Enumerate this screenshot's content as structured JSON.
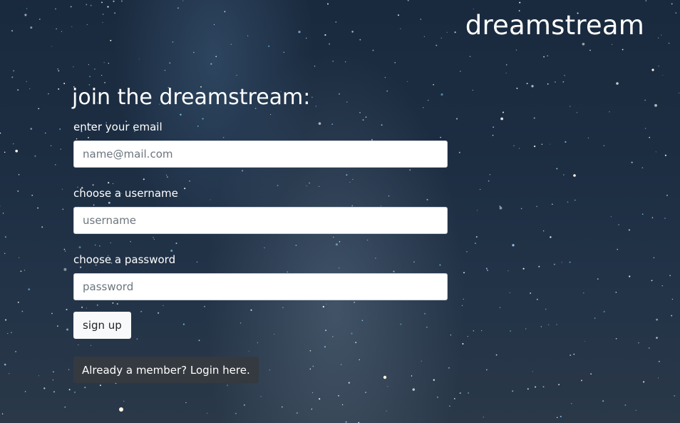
{
  "header": {
    "brand": "dreamstream"
  },
  "form": {
    "title": "join the dreamstream:",
    "fields": [
      {
        "label": "enter your email",
        "placeholder": "name@mail.com",
        "value": ""
      },
      {
        "label": "choose a username",
        "placeholder": "username",
        "value": ""
      },
      {
        "label": "choose a password",
        "placeholder": "password",
        "value": ""
      }
    ],
    "submit_label": "sign up",
    "login_link_label": "Already a member? Login here."
  },
  "colors": {
    "background_sky": "#1c2d42",
    "input_bg": "#ffffff",
    "input_border": "#ced4da",
    "submit_bg": "#f8f9fa",
    "login_bg": "#343a40",
    "text": "#ffffff"
  }
}
